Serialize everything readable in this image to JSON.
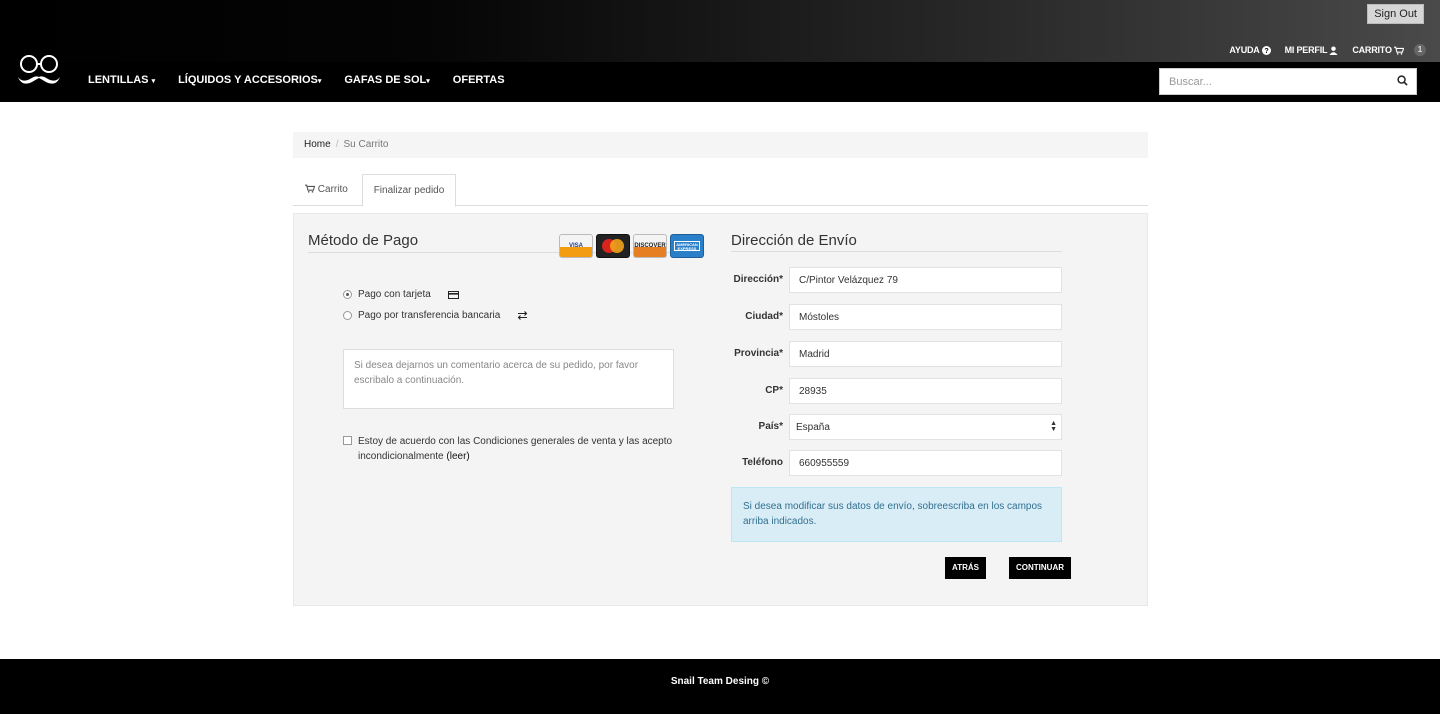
{
  "header": {
    "sign_out": "Sign Out",
    "help": "AYUDA",
    "profile": "MI PERFIL",
    "cart": "CARRITO",
    "cart_count": "1"
  },
  "nav": {
    "items": [
      {
        "label": "LENTILLAS"
      },
      {
        "label": "LÍQUIDOS Y ACCESORIOS"
      },
      {
        "label": "GAFAS DE SOL"
      },
      {
        "label": "OFERTAS"
      }
    ],
    "search_placeholder": "Buscar..."
  },
  "breadcrumb": {
    "home": "Home",
    "current": "Su Carrito"
  },
  "tabs": {
    "cart": "Carrito",
    "checkout": "Finalizar pedido"
  },
  "payment": {
    "title": "Método de Pago",
    "cards": [
      "VISA",
      "MasterCard",
      "DISCOVER",
      "AMERICAN EXPRESS"
    ],
    "options": [
      {
        "label": "Pago con tarjeta",
        "selected": true
      },
      {
        "label": "Pago por transferencia bancaria",
        "selected": false
      }
    ],
    "comment_placeholder": "Si desea dejarnos un comentario acerca de su pedido, por favor escribalo a continuación.",
    "terms_text": "Estoy de acuerdo con las Condiciones generales de venta y las acepto incondicionalmente",
    "terms_link": "(leer)"
  },
  "shipping": {
    "title": "Dirección de Envío",
    "fields": {
      "address": {
        "label": "Dirección*",
        "value": "C/Pintor Velázquez 79"
      },
      "city": {
        "label": "Ciudad*",
        "value": "Móstoles"
      },
      "province": {
        "label": "Provincia*",
        "value": "Madrid"
      },
      "zip": {
        "label": "CP*",
        "value": "28935"
      },
      "country": {
        "label": "País*",
        "value": "España"
      },
      "phone": {
        "label": "Teléfono",
        "value": "660955559"
      }
    },
    "info": "Si desea modificar sus datos de envío, sobreescriba en los campos arriba indicados.",
    "back_button": "ATRÁS",
    "continue_button": "CONTINUAR"
  },
  "footer": {
    "text": "Snail Team Desing ©"
  }
}
